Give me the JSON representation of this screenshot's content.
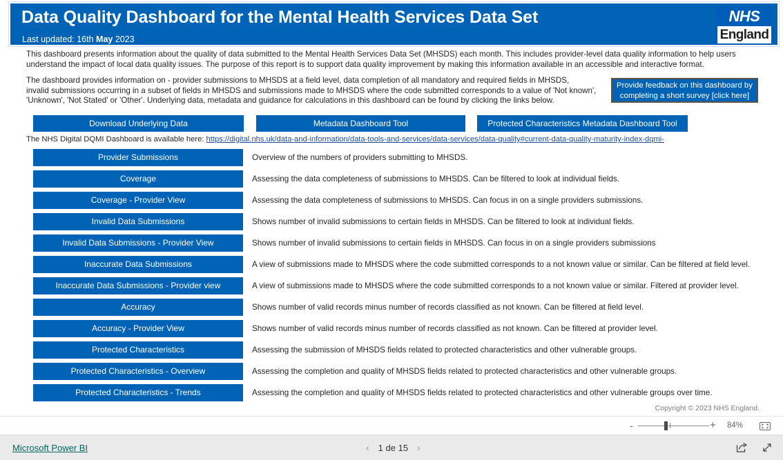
{
  "header": {
    "title": "Data Quality Dashboard for the Mental Health Services Data Set",
    "last_updated_prefix": "Last updated: 16th ",
    "last_updated_month": "May",
    "last_updated_year": " 2023",
    "logo_top": "NHS",
    "logo_bottom": "England",
    "bg_color": "#0063b6"
  },
  "intro": {
    "paragraph1": "This dashboard presents information about the quality of data submitted to the Mental Health Services Data Set (MHSDS) each month. This includes provider-level data quality information to help users understand the impact of local data quality issues. The purpose of this report is to support data quality improvement by making this information available in an accessible and interactive format.",
    "paragraph2": "The dashboard provides information on - provider submissions to MHSDS at a field level, data completion of all mandatory and required fields in MHSDS,",
    "paragraph3": " invalid submissions occurring in a subset of fields in MHSDS and submissions made to MHSDS where the code submitted corresponds to a value of 'Not known',",
    "paragraph4": "'Unknown', 'Not Stated' or 'Other'. Underlying data, metadata and guidance for calculations in this dashboard can be found by clicking the links below."
  },
  "feedback_button": {
    "label": "Provide feedback on this dashboard by completing a short survey [click here]"
  },
  "tool_buttons": [
    {
      "label": "Download Underlying Data"
    },
    {
      "label": "Metadata Dashboard Tool"
    },
    {
      "label": "Protected Characteristics Metadata Dashboard Tool"
    }
  ],
  "dqmi": {
    "prefix": "The NHS Digital DQMI Dashboard is available here: ",
    "url": "https://digital.nhs.uk/data-and-information/data-tools-and-services/data-services/data-quality#current-data-quality-maturity-index-dqmi-"
  },
  "nav_items": [
    {
      "label": "Provider Submissions",
      "description": "Overview of the numbers of providers submitting to MHSDS."
    },
    {
      "label": "Coverage",
      "description": "Assessing the data completeness of submissions to MHSDS. Can be filtered to look at individual fields."
    },
    {
      "label": "Coverage - Provider View",
      "description": "Assessing the data completeness of submissions to MHSDS. Can focus in on a single providers submissions."
    },
    {
      "label": "Invalid Data Submissions",
      "description": "Shows number of invalid submissions to certain fields in MHSDS. Can be filtered to look at individual fields."
    },
    {
      "label": "Invalid Data Submissions - Provider View",
      "description": "Shows number of invalid submissions to certain fields in MHSDS. Can focus in on a single providers submissions"
    },
    {
      "label": "Inaccurate Data Submissions",
      "description": " A view of submissions made to MHSDS where the code submitted corresponds to a not known value or similar. Can be filtered at field level."
    },
    {
      "label": "Inaccurate Data Submissions - Provider view",
      "description": "A view of submissions made to MHSDS where the code submitted corresponds to a not known value or similar. Filtered at provider level."
    },
    {
      "label": "Accuracy",
      "description": "Shows number of valid records minus number of records classified as not known. Can be filtered at field level."
    },
    {
      "label": "Accuracy - Provider View",
      "description": "Shows number of valid records minus number of records classified as not known. Can be filtered at provider level."
    },
    {
      "label": "Protected Characteristics",
      "description": "Assessing the submission of MHSDS fields related to protected characteristics and other vulnerable groups."
    },
    {
      "label": "Protected Characteristics - Overview",
      "description": "Assessing the completion and quality of MHSDS fields related to protected characteristics and other vulnerable groups."
    },
    {
      "label": "Protected Characteristics - Trends",
      "description": "Assessing the completion and quality of MHSDS fields related to protected characteristics and other vulnerable groups over time."
    }
  ],
  "copyright": "Copyright © 2023 NHS England.",
  "zoombar": {
    "minus": "-",
    "plus": "+",
    "percent": "84%",
    "fit_icon": "fit-to-page-icon"
  },
  "bottombar": {
    "powerbi_label": "Microsoft Power BI",
    "prev_arrow": "‹",
    "next_arrow": "›",
    "page_label": "1 de 15",
    "share_icon": "share-icon",
    "fullscreen_icon": "fullscreen-icon"
  }
}
